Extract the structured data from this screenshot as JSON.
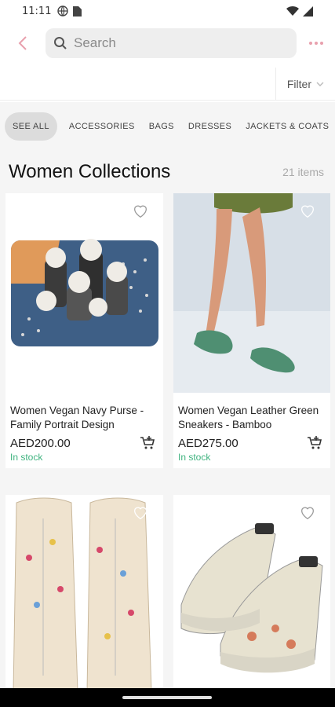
{
  "status_bar": {
    "time": "11:11"
  },
  "search": {
    "placeholder": "Search"
  },
  "filter": {
    "label": "Filter"
  },
  "categories": [
    "SEE ALL",
    "ACCESSORIES",
    "BAGS",
    "DRESSES",
    "JACKETS & COATS"
  ],
  "section": {
    "title": "Women Collections",
    "count": "21 items"
  },
  "products": [
    {
      "name": "Women Vegan Navy Purse - Family Portrait Design",
      "price": "AED200.00",
      "stock": "In stock"
    },
    {
      "name": "Women Vegan Leather Green Sneakers - Bamboo",
      "price": "AED275.00",
      "stock": "In stock"
    },
    {
      "name": "",
      "price": "",
      "stock": ""
    },
    {
      "name": "",
      "price": "",
      "stock": ""
    }
  ],
  "colors": {
    "accent": "#e8a0ad",
    "in_stock": "#3fb37f",
    "strip_bg": "#f5f5f5",
    "chip_active": "#dcdcdc"
  },
  "icons": [
    "back-arrow-icon",
    "search-icon",
    "more-icon",
    "chevron-down-icon",
    "heart-icon",
    "add-to-cart-icon",
    "wifi-icon",
    "signal-icon"
  ]
}
